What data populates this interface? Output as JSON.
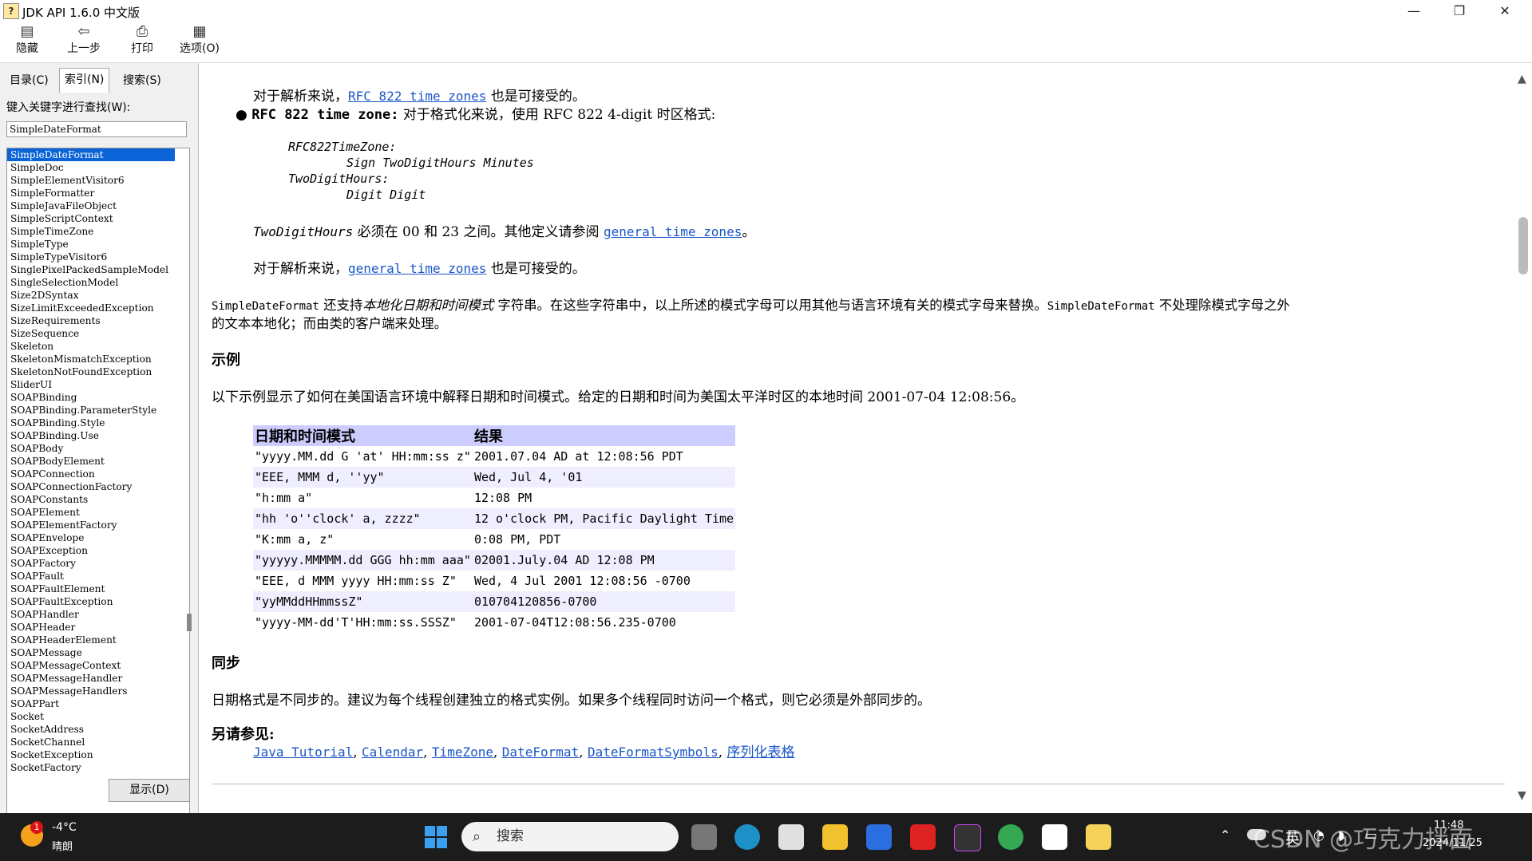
{
  "window": {
    "title": "JDK API 1.6.0 中文版",
    "min": "—",
    "max": "❐",
    "close": "✕"
  },
  "toolbar": {
    "hide": "隐藏",
    "back": "上一步",
    "print": "打印",
    "options": "选项(O)"
  },
  "left": {
    "tabs": [
      "目录(C)",
      "索引(N)",
      "搜索(S)"
    ],
    "keyword_label": "键入关键字进行查找(W):",
    "keyword_value": "SimpleDateFormat",
    "items": [
      "SimpleDateFormat",
      "SimpleDoc",
      "SimpleElementVisitor6",
      "SimpleFormatter",
      "SimpleJavaFileObject",
      "SimpleScriptContext",
      "SimpleTimeZone",
      "SimpleType",
      "SimpleTypeVisitor6",
      "SinglePixelPackedSampleModel",
      "SingleSelectionModel",
      "Size2DSyntax",
      "SizeLimitExceededException",
      "SizeRequirements",
      "SizeSequence",
      "Skeleton",
      "SkeletonMismatchException",
      "SkeletonNotFoundException",
      "SliderUI",
      "SOAPBinding",
      "SOAPBinding.ParameterStyle",
      "SOAPBinding.Style",
      "SOAPBinding.Use",
      "SOAPBody",
      "SOAPBodyElement",
      "SOAPConnection",
      "SOAPConnectionFactory",
      "SOAPConstants",
      "SOAPElement",
      "SOAPElementFactory",
      "SOAPEnvelope",
      "SOAPException",
      "SOAPFactory",
      "SOAPFault",
      "SOAPFaultElement",
      "SOAPFaultException",
      "SOAPHandler",
      "SOAPHeader",
      "SOAPHeaderElement",
      "SOAPMessage",
      "SOAPMessageContext",
      "SOAPMessageHandler",
      "SOAPMessageHandlers",
      "SOAPPart",
      "Socket",
      "SocketAddress",
      "SocketChannel",
      "SocketException",
      "SocketFactory"
    ],
    "show_button": "显示(D)"
  },
  "content": {
    "p1_pre": "对于解析来说，",
    "p1_link": "RFC 822 time zones",
    "p1_post": "也是可接受的。",
    "bullet_bold": "RFC 822 time zone:",
    "bullet_text": "对于格式化来说，使用 RFC 822 4-digit 时区格式:",
    "code1": "RFC822TimeZone:",
    "code2": "Sign TwoDigitHours Minutes",
    "code3": "TwoDigitHours:",
    "code4": "Digit Digit",
    "p2_italic": "TwoDigitHours",
    "p2_text": "必须在 00 和 23 之间。其他定义请参阅",
    "p2_link": "general time zones",
    "p2_end": "。",
    "p3_pre": "对于解析来说，",
    "p3_link": "general time zones",
    "p3_post": "也是可接受的。",
    "p4_a": "SimpleDateFormat",
    "p4_b": "还支持",
    "p4_c": "本地化日期和时间模式",
    "p4_d": "字符串。在这些字符串中，以上所述的模式字母可以用其他与语言环境有关的模式字母来替换。",
    "p4_e": "SimpleDateFormat",
    "p4_f": "不处理除模式字母之外",
    "p4_line2": "的文本本地化；而由类的客户端来处理。",
    "h_example": "示例",
    "p5": "以下示例显示了如何在美国语言环境中解释日期和时间模式。给定的日期和时间为美国太平洋时区的本地时间 2001-07-04 12:08:56。",
    "table_headers": [
      "日期和时间模式",
      "结果"
    ],
    "table_rows": [
      [
        "\"yyyy.MM.dd G 'at' HH:mm:ss z\"",
        "2001.07.04 AD at 12:08:56 PDT"
      ],
      [
        "\"EEE, MMM d, ''yy\"",
        "Wed, Jul 4, '01"
      ],
      [
        "\"h:mm a\"",
        "12:08 PM"
      ],
      [
        "\"hh 'o''clock' a, zzzz\"",
        "12 o'clock PM, Pacific Daylight Time"
      ],
      [
        "\"K:mm a, z\"",
        "0:08 PM, PDT"
      ],
      [
        "\"yyyyy.MMMMM.dd GGG hh:mm aaa\"",
        "02001.July.04 AD 12:08 PM"
      ],
      [
        "\"EEE, d MMM yyyy HH:mm:ss Z\"",
        "Wed, 4 Jul 2001 12:08:56 -0700"
      ],
      [
        "\"yyMMddHHmmssZ\"",
        "010704120856-0700"
      ],
      [
        "\"yyyy-MM-dd'T'HH:mm:ss.SSSZ\"",
        "2001-07-04T12:08:56.235-0700"
      ]
    ],
    "h_sync": "同步",
    "p6": "日期格式是不同步的。建议为每个线程创建独立的格式实例。如果多个线程同时访问一个格式，则它必须是外部同步的。",
    "h_see": "另请参见:",
    "see_links": [
      "Java Tutorial",
      "Calendar",
      "TimeZone",
      "DateFormat",
      "DateFormatSymbols",
      "序列化表格"
    ]
  },
  "taskbar": {
    "weather_temp": "-4°C",
    "weather_desc": "晴朗",
    "weather_badge": "1",
    "search_placeholder": "搜索",
    "lang": "英",
    "time": "11:48",
    "date": "2024/11/25",
    "watermark": "CSDN @巧克力拌面"
  },
  "colors": {
    "link": "#1a56c8",
    "table_header": "#ccccff",
    "table_alt": "#eeeeff",
    "selection": "#0a64d8",
    "taskbar": "#1c1c1c"
  }
}
